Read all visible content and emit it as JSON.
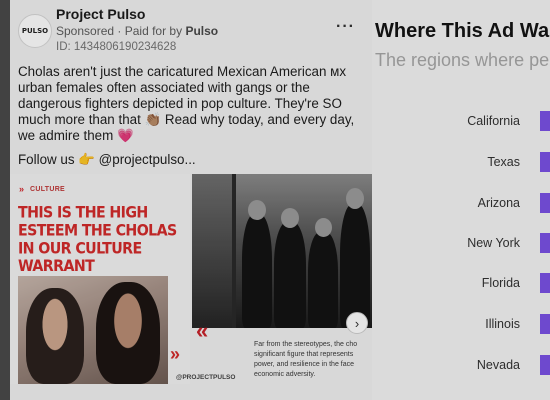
{
  "ad": {
    "advertiser": "Project Pulso",
    "avatar_text": "PULSO",
    "sponsored": "Sponsored",
    "paid_for_prefix": "· Paid for by",
    "payer": "Pulso",
    "id_line": "ID: 1434806190234628",
    "more": "···",
    "body_text": "Cholas aren't just the caricatured Mexican American ᴍx urban females often associated with gangs or the dangerous fighters depicted in pop culture. They're SO much more than that 👏🏽 Read why today, and every day, we admire them 💗",
    "follow_line": "Follow us 👉 @projectpulso...",
    "carousel": {
      "card1": {
        "mark": "»",
        "tag": "CULTURE",
        "headline": "THIS IS THE HIGH ESTEEM THE CHOLAS IN OUR CULTURE WARRANT",
        "handle": "@PROJECTPULSO",
        "chevrons": "»"
      },
      "card2": {
        "chevrons": "«",
        "next": "›",
        "caption": "Far from the stereotypes, the cho significant figure that represents power, and resilience in the face economic adversity."
      }
    }
  },
  "panel": {
    "title": "Where This Ad Wa",
    "subtitle": "The regions where pe",
    "regions": [
      "California",
      "Texas",
      "Arizona",
      "New York",
      "Florida",
      "Illinois",
      "Nevada"
    ]
  },
  "colors": {
    "accent": "#7b52e6",
    "brand_red": "#d42b2b"
  }
}
